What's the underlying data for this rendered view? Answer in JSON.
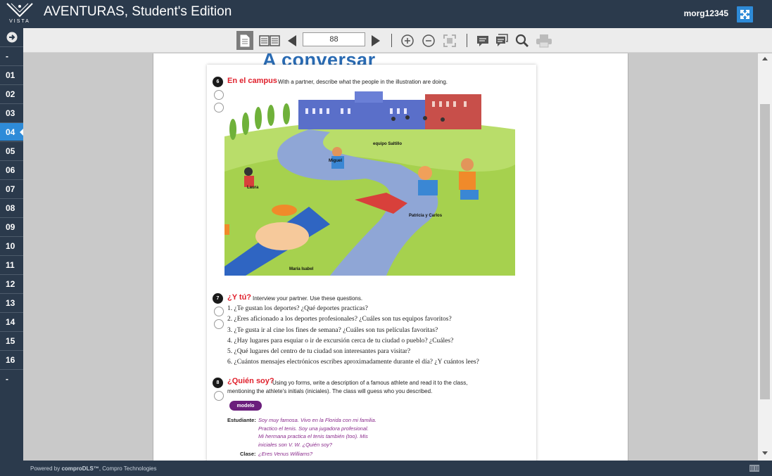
{
  "header": {
    "logo_text": "VISTA",
    "title": "AVENTURAS, Student's Edition",
    "username": "morg12345"
  },
  "toolbar": {
    "page_number": "88"
  },
  "sidebar": {
    "items": [
      "-",
      "01",
      "02",
      "03",
      "04",
      "05",
      "06",
      "07",
      "08",
      "09",
      "10",
      "11",
      "12",
      "13",
      "14",
      "15",
      "16",
      "-"
    ],
    "active_index": 4
  },
  "page": {
    "heading": "A conversar",
    "activity6": {
      "number": "6",
      "title": "En el campus",
      "instruction": "With a partner, describe what the people in the illustration are doing.",
      "labels": [
        "equipo Saltillo",
        "Miguel",
        "Laura",
        "Patricia y Carlos",
        "María Isabel"
      ]
    },
    "activity7": {
      "number": "7",
      "title": "¿Y tú?",
      "instruction": "Interview your partner. Use these questions.",
      "questions": [
        "1. ¿Te gustan los deportes? ¿Qué deportes practicas?",
        "2. ¿Eres aficionado a los deportes profesionales? ¿Cuáles son tus equipos favoritos?",
        "3. ¿Te gusta ir al cine los fines de semana? ¿Cuáles son tus películas favoritas?",
        "4. ¿Hay lugares para esquiar o ir de excursión cerca de tu ciudad o pueblo? ¿Cuáles?",
        "5. ¿Qué lugares del centro de tu ciudad son interesantes para visitar?",
        "6. ¿Cuántos mensajes electrónicos escribes aproximadamente durante el día? ¿Y cuántos lees?"
      ]
    },
    "activity8": {
      "number": "8",
      "title": "¿Quién soy?",
      "instruction_line1": "Using yo forms, write a description of a famous athlete and read it to the class,",
      "instruction_line2": "mentioning the athlete's initials (iniciales). The class will guess who you described.",
      "modelo": "modelo",
      "student_label": "Estudiante:",
      "student_lines": [
        "Soy muy famosa. Vivo en la Florida con mi familia.",
        "Practico el tenis. Soy una jugadora profesional.",
        "Mi hermana practica el tenis también (too). Mis",
        "iniciales son V. W. ¿Quién soy?"
      ],
      "class_label": "Clase:",
      "class_line": "¿Eres Venus Williams?"
    }
  },
  "footer": {
    "powered_prefix": "Powered by ",
    "brand": "comproDLS™",
    "suffix": ", Compro Technologies"
  },
  "colors": {
    "navy": "#2b3a4c",
    "accent_blue": "#2e8bd8",
    "red_title": "#e0202c",
    "purple_modelo": "#6b1e7c"
  }
}
